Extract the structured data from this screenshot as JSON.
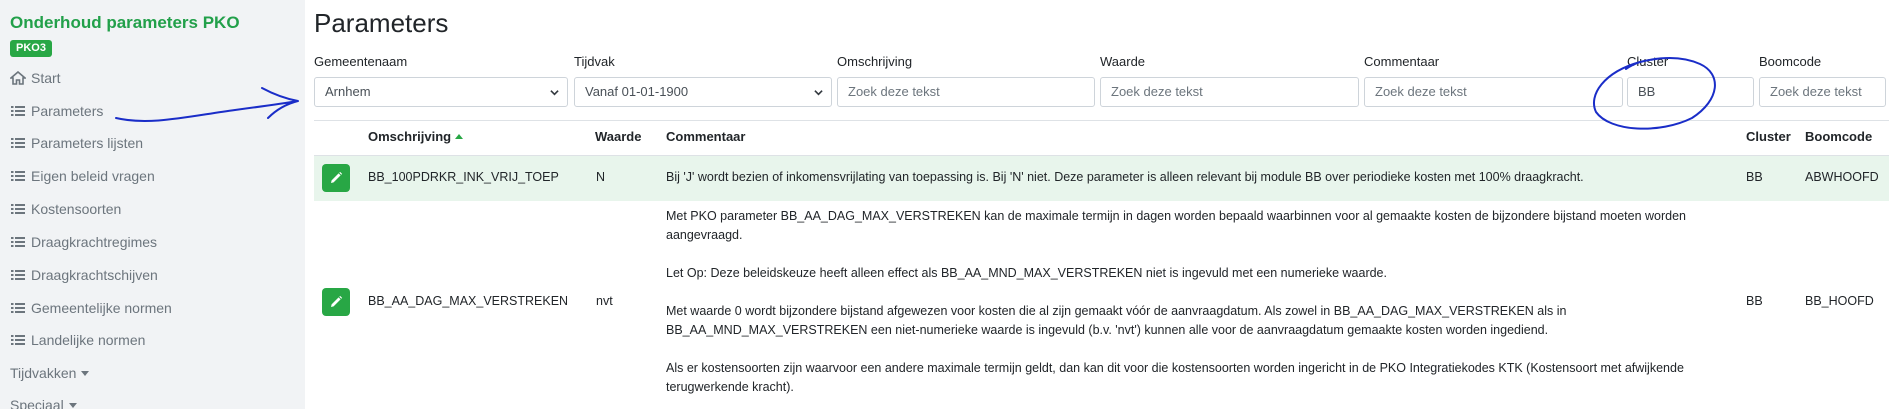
{
  "sidebar": {
    "app_title": "Onderhoud parameters PKO",
    "badge": "PKO3",
    "items": [
      {
        "label": "Start",
        "icon": "home-icon"
      },
      {
        "label": "Parameters",
        "icon": "list-icon"
      },
      {
        "label": "Parameters lijsten",
        "icon": "list-icon"
      },
      {
        "label": "Eigen beleid vragen",
        "icon": "list-icon"
      },
      {
        "label": "Kostensoorten",
        "icon": "list-icon"
      },
      {
        "label": "Draagkrachtregimes",
        "icon": "list-icon"
      },
      {
        "label": "Draagkrachtschijven",
        "icon": "list-icon"
      },
      {
        "label": "Gemeentelijke normen",
        "icon": "list-icon"
      },
      {
        "label": "Landelijke normen",
        "icon": "list-icon"
      },
      {
        "label": "Tijdvakken",
        "icon": "caret-down-icon"
      },
      {
        "label": "Speciaal",
        "icon": "caret-down-icon"
      }
    ]
  },
  "page": {
    "title": "Parameters"
  },
  "filters": {
    "gemeentenaam": {
      "label": "Gemeentenaam",
      "value": "Arnhem"
    },
    "tijdvak": {
      "label": "Tijdvak",
      "value": "Vanaf 01-01-1900"
    },
    "omschrijving": {
      "label": "Omschrijving",
      "placeholder": "Zoek deze tekst"
    },
    "waarde": {
      "label": "Waarde",
      "placeholder": "Zoek deze tekst"
    },
    "commentaar": {
      "label": "Commentaar",
      "placeholder": "Zoek deze tekst"
    },
    "cluster": {
      "label": "Cluster",
      "value": "BB"
    },
    "boomcode": {
      "label": "Boomcode",
      "placeholder": "Zoek deze tekst"
    }
  },
  "table": {
    "headers": {
      "omschrijving": "Omschrijving",
      "waarde": "Waarde",
      "commentaar": "Commentaar",
      "cluster": "Cluster",
      "boomcode": "Boomcode"
    },
    "rows": [
      {
        "omschrijving": "BB_100PDRKR_INK_VRIJ_TOEP",
        "waarde": "N",
        "commentaar": [
          "Bij 'J' wordt bezien of inkomensvrijlating van toepassing is. Bij 'N' niet. Deze parameter is alleen relevant bij module BB over periodieke kosten met 100% draagkracht."
        ],
        "cluster": "BB",
        "boomcode": "ABWHOOFD"
      },
      {
        "omschrijving": "BB_AA_DAG_MAX_VERSTREKEN",
        "waarde": "nvt",
        "commentaar": [
          "Met PKO parameter BB_AA_DAG_MAX_VERSTREKEN kan de maximale termijn in dagen worden bepaald waarbinnen voor al gemaakte kosten de bijzondere bijstand moeten worden aangevraagd.",
          "Let Op: Deze beleidskeuze heeft alleen effect als BB_AA_MND_MAX_VERSTREKEN niet is ingevuld met een numerieke waarde.",
          "Met waarde 0 wordt bijzondere bijstand afgewezen voor kosten die al zijn gemaakt vóór de aanvraagdatum. Als zowel in BB_AA_DAG_MAX_VERSTREKEN als in BB_AA_MND_MAX_VERSTREKEN een niet-numerieke waarde is ingevuld (b.v. 'nvt') kunnen alle voor de aanvraagdatum gemaakte kosten worden ingediend.",
          "Als er kostensoorten zijn waarvoor een andere maximale termijn geldt, dan kan dit voor die kostensoorten worden ingericht in de PKO Integratiekodes KTK (Kostensoort met afwijkende terugwerkende kracht)."
        ],
        "cluster": "BB",
        "boomcode": "BB_HOOFD"
      }
    ]
  },
  "colors": {
    "accent": "#28a745",
    "title_green": "#22a04a",
    "annotation_ink": "#1a2dc8"
  }
}
